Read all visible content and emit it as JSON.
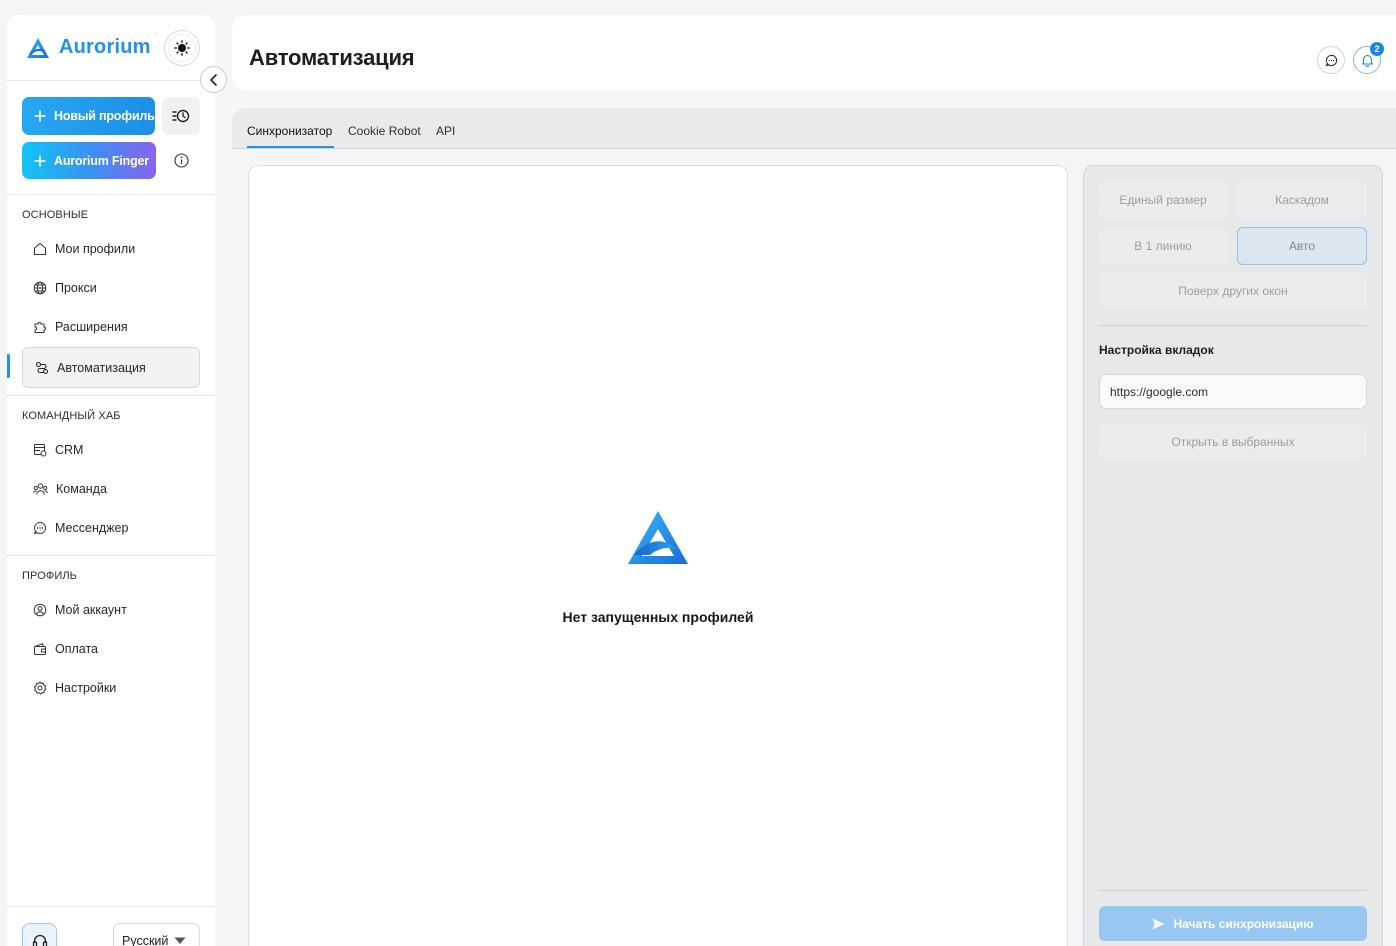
{
  "brand": {
    "name": "Aurorium",
    "accent": "#2291e8"
  },
  "sidebar": {
    "new_profile_label": "Новый профиль",
    "finger_label": "Aurorium Finger",
    "sections": [
      {
        "title": "ОСНОВНЫЕ",
        "items": [
          {
            "label": "Мои профили",
            "icon": "home-icon"
          },
          {
            "label": "Прокси",
            "icon": "globe-icon"
          },
          {
            "label": "Расширения",
            "icon": "puzzle-icon"
          },
          {
            "label": "Автоматизация",
            "icon": "automation-icon",
            "active": true
          }
        ]
      },
      {
        "title": "КОМАНДНЫЙ ХАБ",
        "items": [
          {
            "label": "CRM",
            "icon": "crm-icon"
          },
          {
            "label": "Команда",
            "icon": "team-icon"
          },
          {
            "label": "Мессенджер",
            "icon": "chat-icon"
          }
        ]
      },
      {
        "title": "ПРОФИЛЬ",
        "items": [
          {
            "label": "Мой аккаунт",
            "icon": "account-icon"
          },
          {
            "label": "Оплата",
            "icon": "wallet-icon"
          },
          {
            "label": "Настройки",
            "icon": "gear-icon"
          }
        ]
      }
    ],
    "language": "Русский"
  },
  "header": {
    "title": "Автоматизация",
    "notification_count": "2"
  },
  "tabs": [
    {
      "label": "Синхронизатор",
      "active": true
    },
    {
      "label": "Cookie Robot"
    },
    {
      "label": "API"
    }
  ],
  "preview": {
    "empty_text": "Нет запущенных профилей"
  },
  "settings": {
    "layout_options": [
      "Единый размер",
      "Каскадом",
      "В 1 линию",
      "Авто"
    ],
    "selected_layout": "Авто",
    "on_top_label": "Поверх других окон",
    "tabs_label": "Настройка вкладок",
    "url_value": "https://google.com",
    "open_selected_label": "Открыть в выбранных",
    "start_sync_label": "Начать синхронизацию"
  }
}
